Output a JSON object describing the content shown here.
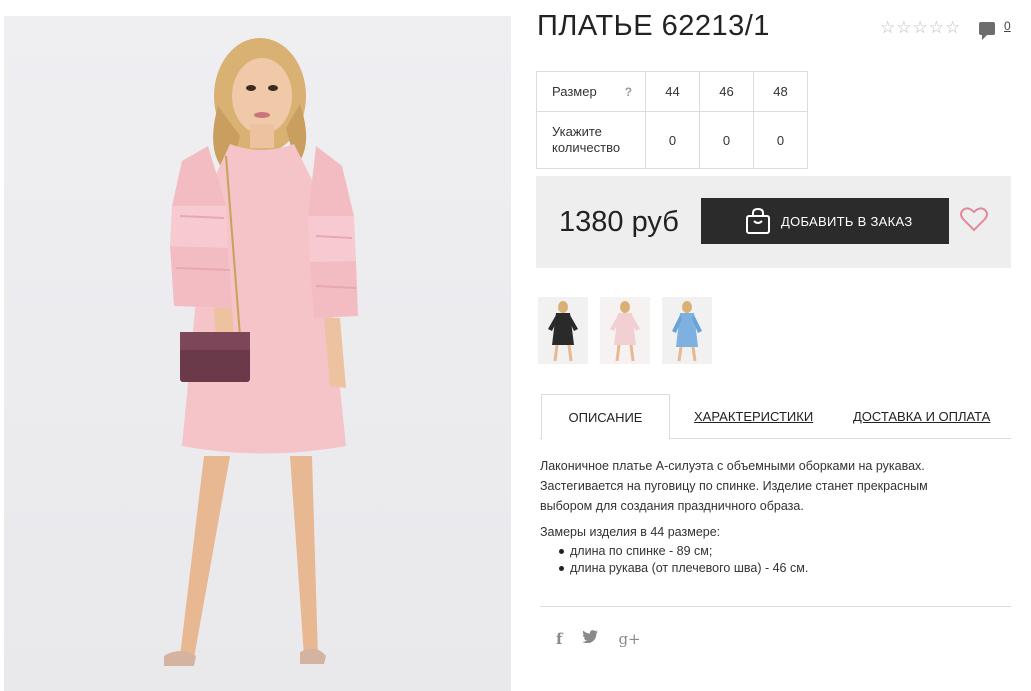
{
  "product": {
    "title": "ПЛАТЬЕ 62213/1",
    "rating_stars": 5,
    "comment_count": "0",
    "price": "1380 руб",
    "add_button_label": "ДОБАВИТЬ В ЗАКАЗ"
  },
  "size_table": {
    "size_label": "Размер",
    "help_mark": "?",
    "sizes": [
      "44",
      "46",
      "48"
    ],
    "quantity_label": "Укажите количество",
    "quantities": [
      "0",
      "0",
      "0"
    ]
  },
  "thumbnails": [
    {
      "name": "thumbnail-black-dress",
      "color": "#2a2a2a"
    },
    {
      "name": "thumbnail-pink-dress",
      "color": "#f2cfd2"
    },
    {
      "name": "thumbnail-blue-dress",
      "color": "#7fb1e0"
    }
  ],
  "tabs": [
    {
      "label": "ОПИСАНИЕ",
      "active": true
    },
    {
      "label": "ХАРАКТЕРИСТИКИ",
      "active": false
    },
    {
      "label": "ДОСТАВКА И ОПЛАТА",
      "active": false
    }
  ],
  "description": {
    "text": "Лаконичное платье А-силуэта с объемными оборками на рукавах. Застегивается на пуговицу по спинке. Изделие станет прекрасным выбором для создания праздничного образа.",
    "measures_title": "Замеры изделия в 44 размере:",
    "measures": [
      "длина по спинке - 89 см;",
      "длина рукава (от плечевого шва) - 46 см."
    ]
  },
  "social": {
    "facebook_glyph": "f",
    "google_glyph": "g+"
  },
  "colors": {
    "dress_pink": "#f4c4c9",
    "button_bg": "#2b2b2b",
    "heart": "#e28a9b",
    "buy_box_bg": "#eeeeee"
  }
}
